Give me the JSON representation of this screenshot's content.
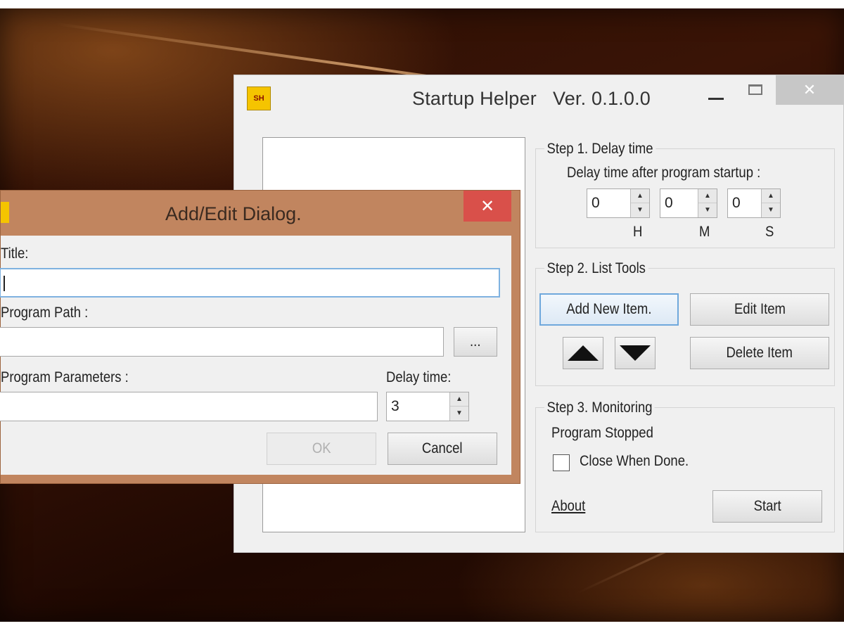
{
  "main_window": {
    "title": "Startup Helper   Ver. 0.1.0.0",
    "icon_text": "SH",
    "controls": {
      "minimize": "minimize-icon",
      "maximize": "maximize-icon",
      "close": "✕"
    },
    "step1": {
      "title": "Step 1. Delay time",
      "label": "Delay time after program startup :",
      "hours": {
        "value": "0",
        "unit": "H"
      },
      "minutes": {
        "value": "0",
        "unit": "M"
      },
      "seconds": {
        "value": "0",
        "unit": "S"
      }
    },
    "step2": {
      "title": "Step 2. List Tools",
      "add_label": "Add New Item.",
      "edit_label": "Edit Item",
      "delete_label": "Delete Item",
      "move_up_icon": "triangle-up-icon",
      "move_down_icon": "triangle-down-icon"
    },
    "step3": {
      "title": "Step 3. Monitoring",
      "status": "Program Stopped",
      "close_when_done": "Close When Done.",
      "close_when_done_checked": false,
      "about": "About",
      "start": "Start"
    }
  },
  "dialog": {
    "title": "Add/Edit Dialog.",
    "close": "✕",
    "title_label": "Title:",
    "title_value": "",
    "path_label": "Program Path :",
    "path_value": "",
    "browse_label": "...",
    "params_label": "Program Parameters :",
    "params_value": "",
    "delay_label": "Delay time:",
    "delay_value": "3",
    "ok_label": "OK",
    "cancel_label": "Cancel"
  },
  "colors": {
    "dialog_border": "#c1855f",
    "dialog_close": "#d9504a",
    "focus_blue": "#6fa8dc",
    "window_bg": "#f0f0f0"
  }
}
